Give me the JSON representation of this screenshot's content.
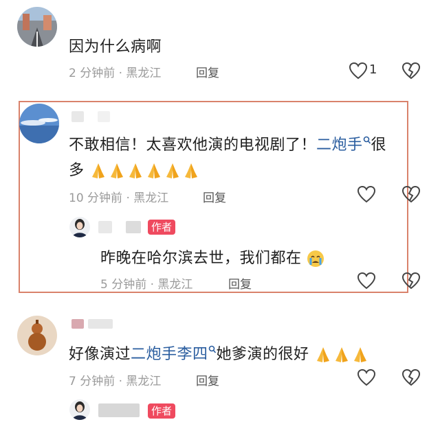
{
  "comments": [
    {
      "text": "因为什么病啊",
      "meta": "2 分钟前 · 黑龙江",
      "reply_label": "回复",
      "likes": "1"
    },
    {
      "text_before_link": "不敢相信！太喜欢他演的电视剧了！",
      "link": "二炮手",
      "text_after_link": "很",
      "line2": "多",
      "meta": "10 分钟前 · 黑龙江",
      "reply_label": "回复"
    },
    {
      "badge": "作者",
      "text": "昨晚在哈尔滨去世，我们都在",
      "meta": "5 分钟前 · 黑龙江",
      "reply_label": "回复"
    },
    {
      "text_before_link": "好像演过",
      "link": "二炮手李四",
      "text_after_link": "她爹演的很好",
      "meta": "7 分钟前 · 黑龙江",
      "reply_label": "回复"
    },
    {
      "badge": "作者"
    }
  ],
  "icons": {
    "like": "heart-icon",
    "dislike": "broken-heart-icon",
    "search_tag": "search-tag-icon",
    "pray_emoji": "pray-emoji",
    "cry_emoji": "cry-emoji"
  },
  "colors": {
    "highlight_border": "#d9826b",
    "link": "#2a5d9f",
    "badge": "#ef4a5f",
    "meta": "#9a9a9a"
  }
}
